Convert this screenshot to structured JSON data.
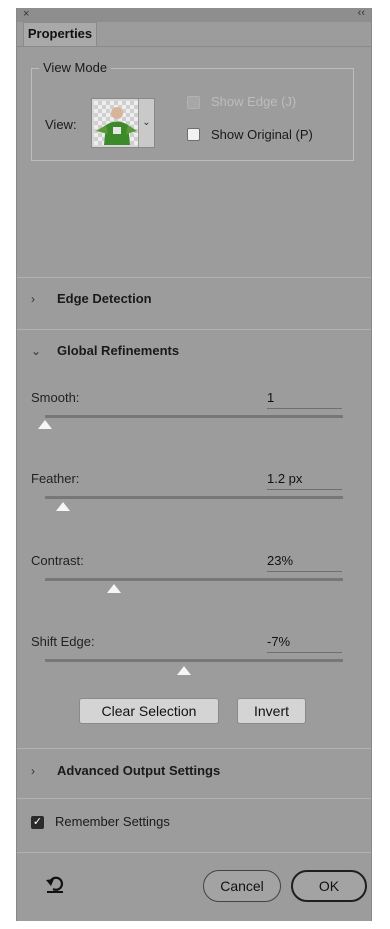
{
  "window": {
    "close_glyph": "×",
    "collapse_glyph": "‹‹"
  },
  "tab": {
    "label": "Properties"
  },
  "view_mode": {
    "group_title": "View Mode",
    "view_label": "View:",
    "show_edge_label": "Show Edge (J)",
    "show_edge_checked": false,
    "show_edge_disabled": true,
    "show_original_label": "Show Original (P)",
    "show_original_checked": false
  },
  "sections": {
    "edge_detection": {
      "label": "Edge Detection",
      "expanded": false
    },
    "global_refinements": {
      "label": "Global Refinements",
      "expanded": true
    },
    "advanced_output": {
      "label": "Advanced Output Settings",
      "expanded": false
    }
  },
  "sliders": {
    "smooth": {
      "label": "Smooth:",
      "value_text": "1",
      "position": 0.0
    },
    "feather": {
      "label": "Feather:",
      "value_text": "1.2 px",
      "position": 0.06
    },
    "contrast": {
      "label": "Contrast:",
      "value_text": "23%",
      "position": 0.23
    },
    "shift_edge": {
      "label": "Shift Edge:",
      "value_text": "-7%",
      "position": 0.465
    }
  },
  "buttons": {
    "clear_selection": "Clear Selection",
    "invert": "Invert",
    "cancel": "Cancel",
    "ok": "OK"
  },
  "remember": {
    "label": "Remember Settings",
    "checked": true
  },
  "colors": {
    "panel_bg": "#9c9c9c",
    "thumb_subject_green": "#3c8a2a"
  },
  "icons": {
    "reset": "undo-arrow-icon",
    "collapsed_chevron": "chevron-right-icon",
    "expanded_chevron": "chevron-down-icon"
  }
}
